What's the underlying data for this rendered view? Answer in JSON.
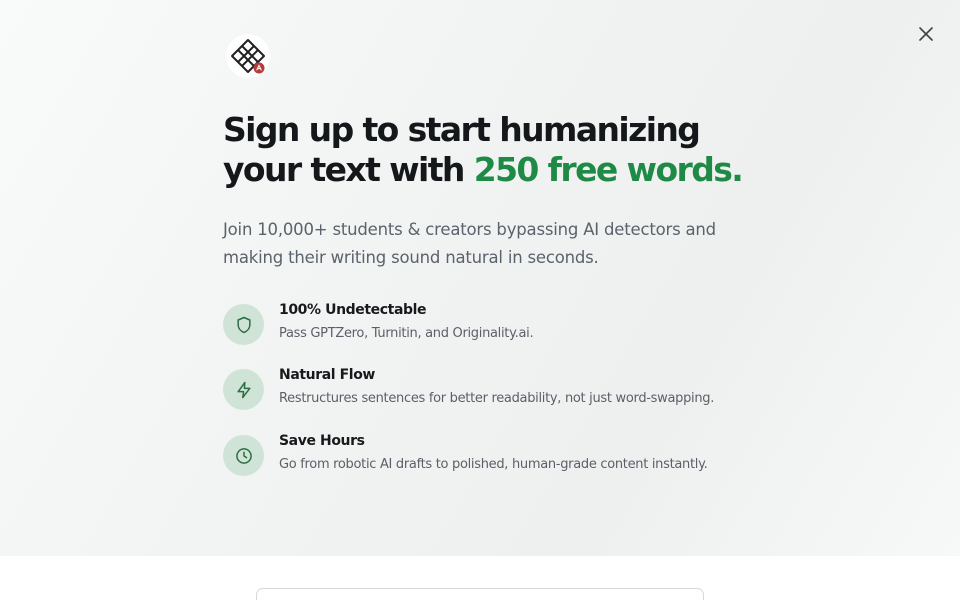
{
  "headline": {
    "line1": "Sign up to start humanizing",
    "line2_prefix": "your text with ",
    "line2_accent": "250 free words."
  },
  "subtitle": "Join 10,000+ students & creators bypassing AI detectors and making their writing sound natural in seconds.",
  "features": [
    {
      "icon": "shield-icon",
      "title": "100% Undetectable",
      "description": "Pass GPTZero, Turnitin, and Originality.ai."
    },
    {
      "icon": "lightning-icon",
      "title": "Natural Flow",
      "description": "Restructures sentences for better readability, not just word-swapping."
    },
    {
      "icon": "clock-icon",
      "title": "Save Hours",
      "description": "Go from robotic AI drafts to polished, human-grade content instantly."
    }
  ],
  "colors": {
    "accent": "#1f8a45",
    "icon_bg": "#cfe4d6",
    "heading": "#15181b",
    "body_text": "#5a626b"
  }
}
